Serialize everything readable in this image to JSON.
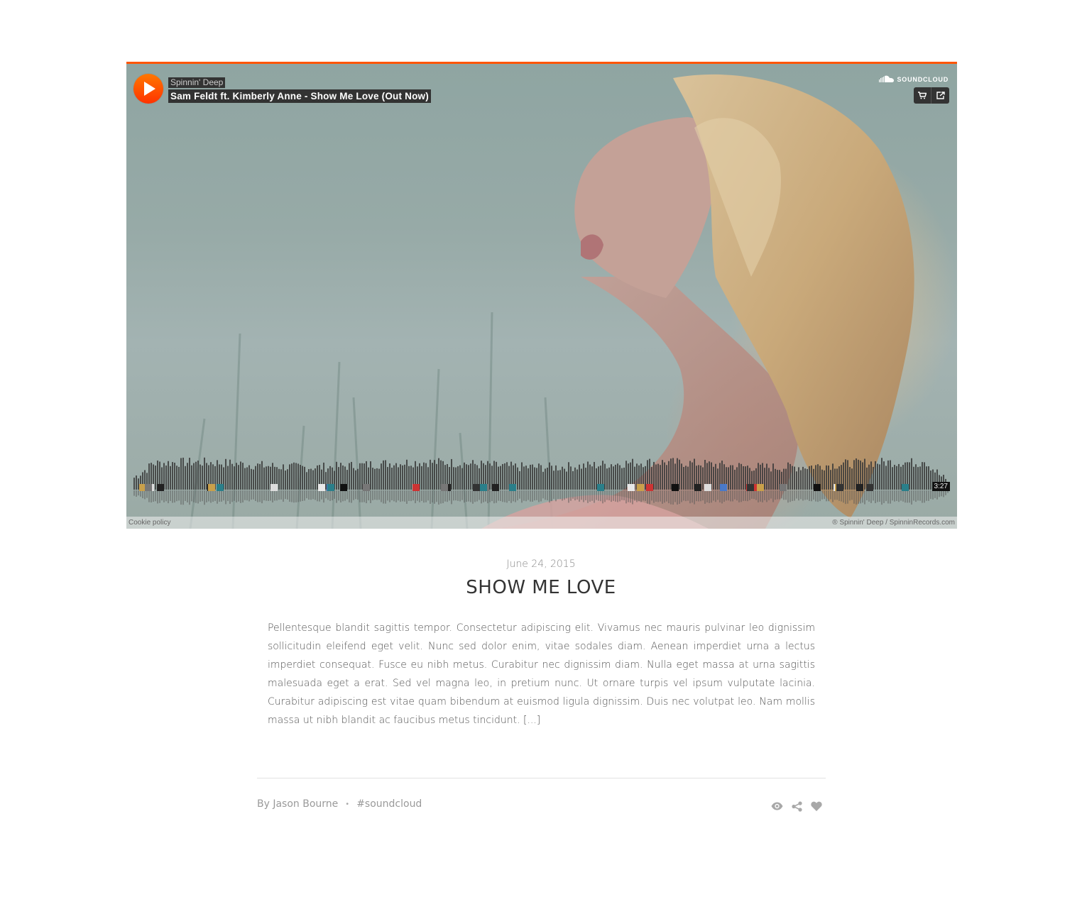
{
  "player": {
    "user": "Spinnin' Deep",
    "title": "Sam Feldt ft. Kimberly Anne - Show Me Love (Out Now)",
    "brand": "SOUNDCLOUD",
    "duration": "3:27",
    "cookie_policy": "Cookie policy",
    "copyright": "® Spinnin' Deep / SpinninRecords.com",
    "accent_color": "#ff5500",
    "icons": {
      "play": "play-icon",
      "buy": "cart-icon",
      "share": "share-icon",
      "logo": "soundcloud-cloud-icon"
    }
  },
  "post": {
    "date": "June 24, 2015",
    "title": "SHOW ME LOVE",
    "body": "Pellentesque blandit sagittis tempor. Consectetur adipiscing elit. Vivamus nec mauris pulvinar leo dignissim sollicitudin eleifend eget velit. Nunc sed dolor enim, vitae sodales diam. Aenean imperdiet urna a lectus imperdiet consequat. Fusce eu nibh metus. Curabitur nec dignissim diam. Nulla eget massa at urna sagittis malesuada eget a erat. Sed vel magna leo, in pretium nunc. Ut ornare turpis vel ipsum vulputate lacinia. Curabitur adipiscing est vitae quam bibendum at euismod ligula dignissim. Duis nec volutpat leo. Nam mollis massa ut nibh blandit ac faucibus metus tincidunt.",
    "read_more": "[...]",
    "author": "By Jason Bourne",
    "separator": "•",
    "tag": "#soundcloud",
    "actions": [
      "eye-icon",
      "share-icon",
      "heart-icon"
    ]
  }
}
